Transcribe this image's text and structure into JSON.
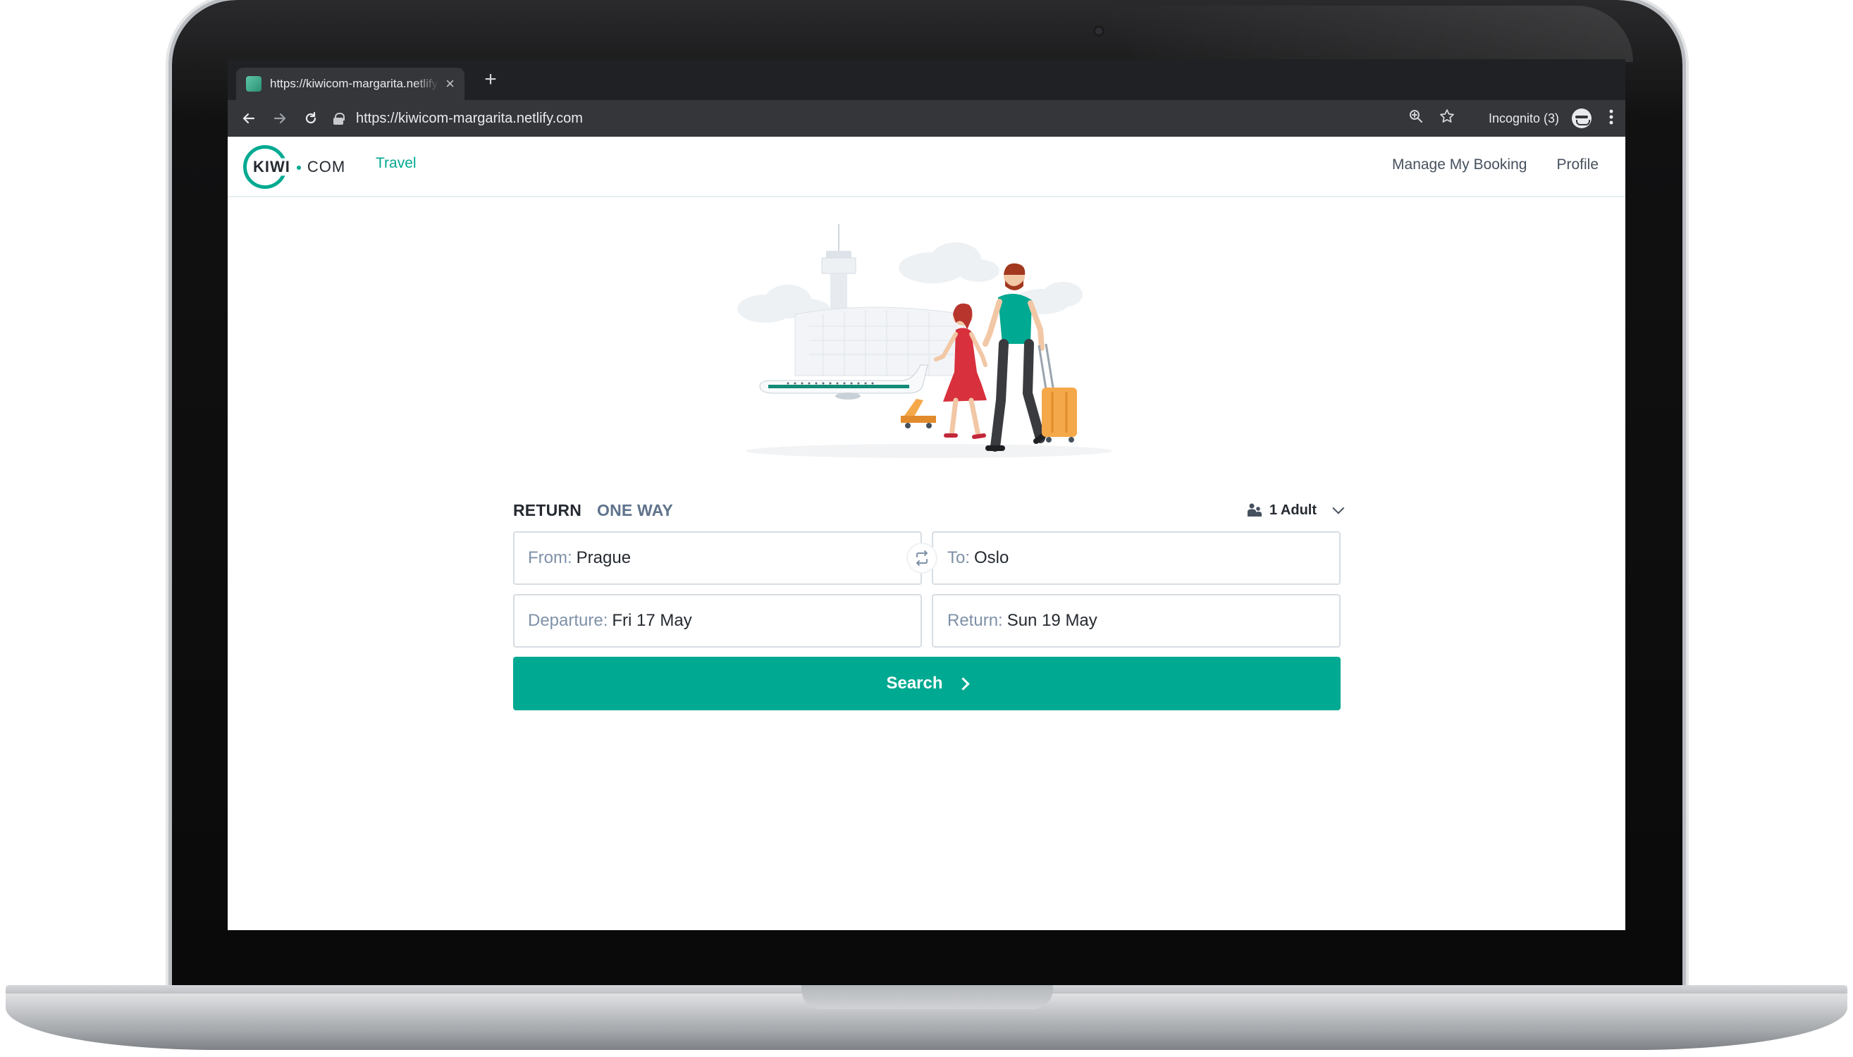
{
  "browser": {
    "tab_title": "https://kiwicom-margarita.netlify.com",
    "tab_close": "×",
    "new_tab": "+",
    "url": "https://kiwicom-margarita.netlify.com",
    "incognito_label": "Incognito (3)",
    "back_icon": "arrow-left-icon",
    "forward_icon": "arrow-right-icon",
    "reload_icon": "reload-icon",
    "zoom_icon": "zoom-icon",
    "star_icon": "star-icon",
    "menu_icon": "kebab-menu-icon"
  },
  "header": {
    "logo_left": "KIWI",
    "logo_right": "COM",
    "nav_travel": "Travel",
    "nav_manage": "Manage My Booking",
    "nav_profile": "Profile"
  },
  "search": {
    "trip_return": "RETURN",
    "trip_oneway": "ONE WAY",
    "passengers": "1 Adult",
    "from_label": "From:",
    "from_value": "Prague",
    "to_label": "To:",
    "to_value": "Oslo",
    "departure_label": "Departure:",
    "departure_value": "Fri 17 May",
    "return_label": "Return:",
    "return_value": "Sun 19 May",
    "button": "Search"
  },
  "colors": {
    "brand": "#00a991",
    "text_dark": "#252a31",
    "text_muted": "#7f91a8",
    "browser_dark": "#202124"
  }
}
